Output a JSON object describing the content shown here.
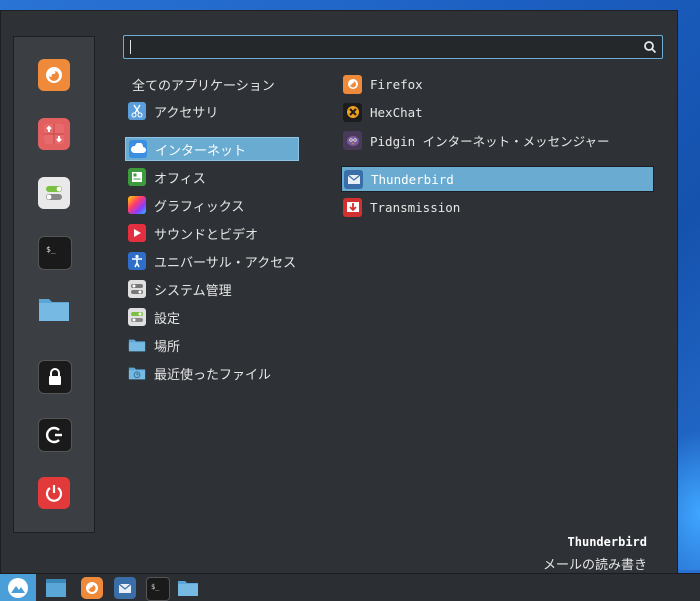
{
  "search": {
    "value": "",
    "placeholder": ""
  },
  "favorites": [
    {
      "name": "Firefox",
      "icon": "firefox-icon"
    },
    {
      "name": "Software Manager",
      "icon": "software-manager-icon"
    },
    {
      "name": "Settings",
      "icon": "settings-toggle-icon"
    },
    {
      "name": "Terminal",
      "icon": "terminal-icon"
    },
    {
      "name": "Files",
      "icon": "folder-icon"
    },
    {
      "name": "Lock Screen",
      "icon": "lock-icon"
    },
    {
      "name": "Log Out",
      "icon": "logout-icon"
    },
    {
      "name": "Shut Down",
      "icon": "power-icon"
    }
  ],
  "categories": {
    "all": "全てのアプリケーション",
    "items": [
      {
        "label": "アクセサリ",
        "icon": "scissors-icon",
        "selected": false
      },
      {
        "label": "インターネット",
        "icon": "cloud-icon",
        "selected": true
      },
      {
        "label": "オフィス",
        "icon": "office-icon",
        "selected": false
      },
      {
        "label": "グラフィックス",
        "icon": "graphics-icon",
        "selected": false
      },
      {
        "label": "サウンドとビデオ",
        "icon": "play-icon",
        "selected": false
      },
      {
        "label": "ユニバーサル・アクセス",
        "icon": "accessibility-icon",
        "selected": false
      },
      {
        "label": "システム管理",
        "icon": "system-admin-icon",
        "selected": false
      },
      {
        "label": "設定",
        "icon": "settings-icon",
        "selected": false
      },
      {
        "label": "場所",
        "icon": "places-folder-icon",
        "selected": false
      },
      {
        "label": "最近使ったファイル",
        "icon": "recent-files-icon",
        "selected": false
      }
    ]
  },
  "apps": [
    {
      "label": "Firefox",
      "icon": "firefox-icon",
      "selected": false
    },
    {
      "label": "HexChat",
      "icon": "hexchat-icon",
      "selected": false
    },
    {
      "label": "Pidgin インターネット・メッセンジャー",
      "icon": "pidgin-icon",
      "selected": false
    },
    {
      "label": "Thunderbird",
      "icon": "thunderbird-icon",
      "selected": true
    },
    {
      "label": "Transmission",
      "icon": "transmission-icon",
      "selected": false
    }
  ],
  "description": {
    "name": "Thunderbird",
    "text": "メールの読み書き"
  },
  "taskbar": {
    "items": [
      {
        "name": "Show Desktop",
        "icon": "desktop-icon"
      },
      {
        "name": "Firefox",
        "icon": "firefox-icon"
      },
      {
        "name": "Thunderbird",
        "icon": "thunderbird-icon"
      },
      {
        "name": "Terminal",
        "icon": "terminal-icon"
      },
      {
        "name": "Files",
        "icon": "folder-icon"
      }
    ]
  },
  "colors": {
    "accent": "#6aabd2",
    "menu_bg": "#2e3236",
    "favbar_bg": "#3b3f43"
  }
}
